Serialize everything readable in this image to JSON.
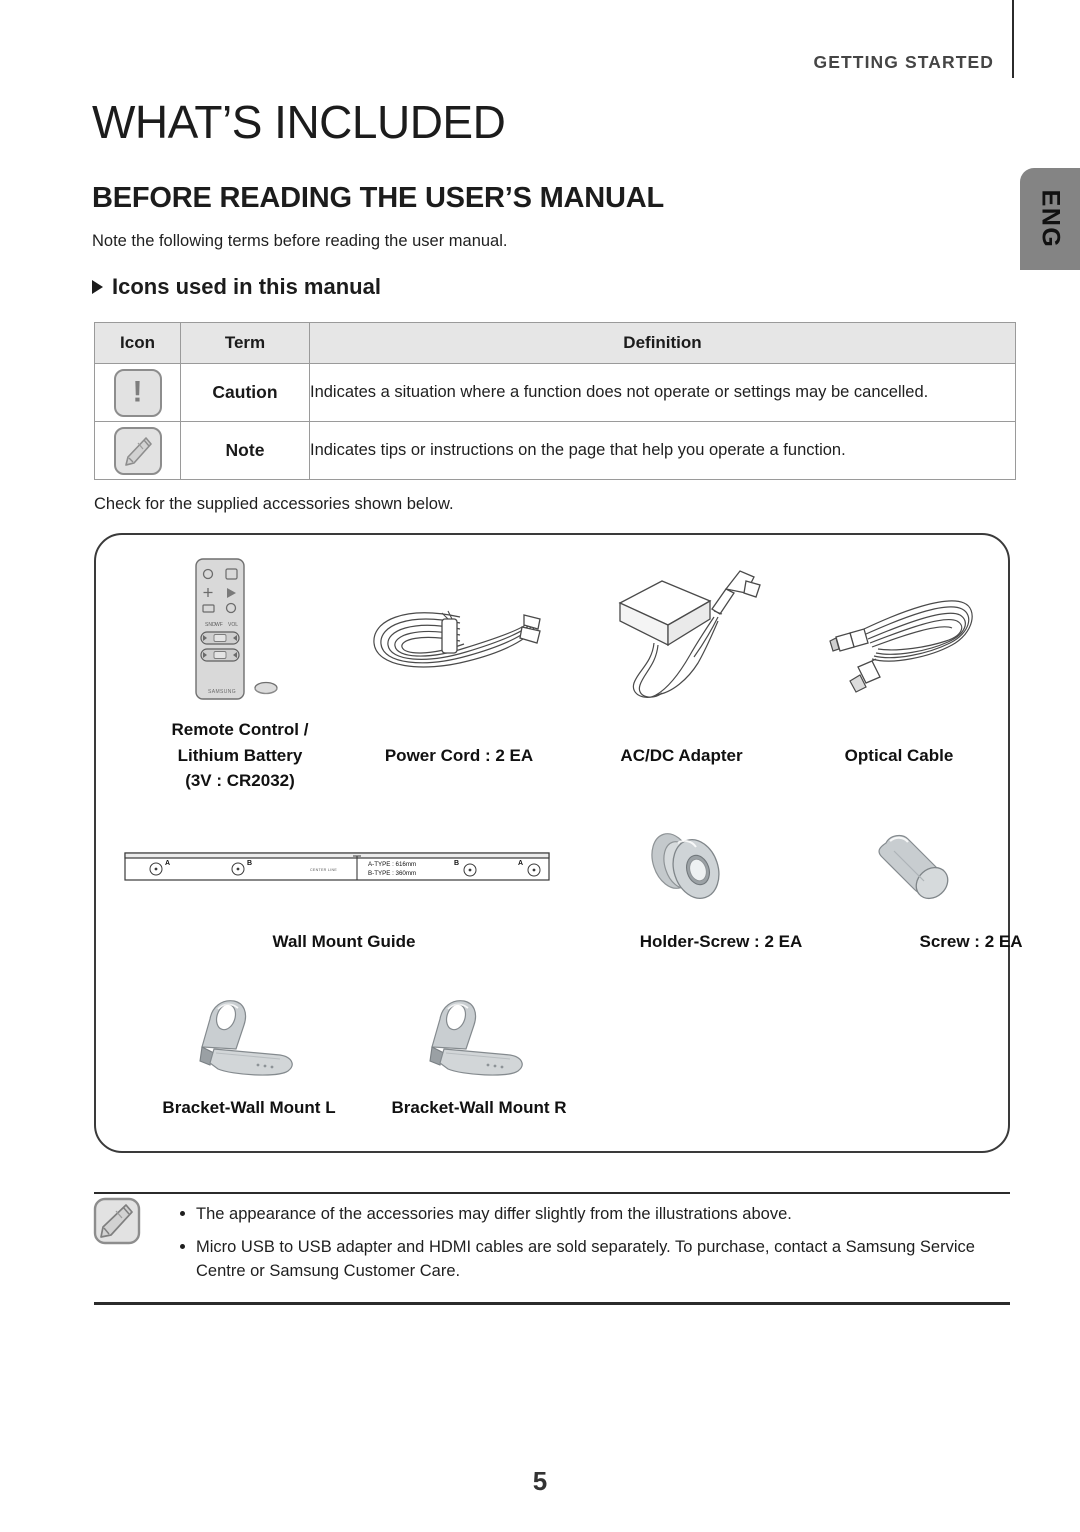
{
  "header": {
    "running_head": "GETTING STARTED",
    "language_tab": "ENG"
  },
  "page_title": "WHAT’S INCLUDED",
  "section_title": "BEFORE READING THE USER’S MANUAL",
  "intro_text": "Note the following terms before reading the user manual.",
  "sub_heading": "Icons used in this manual",
  "icon_table": {
    "headers": [
      "Icon",
      "Term",
      "Definition"
    ],
    "rows": [
      {
        "icon": "caution-icon",
        "term": "Caution",
        "definition": "Indicates a situation where a function does not operate or settings may be cancelled."
      },
      {
        "icon": "note-icon",
        "term": "Note",
        "definition": "Indicates tips or instructions on the page that help you operate a function."
      }
    ]
  },
  "check_text": "Check for the supplied accessories shown below.",
  "accessories": [
    {
      "name": "remote-control",
      "label_lines": [
        "Remote Control /",
        "Lithium Battery",
        "(3V : CR2032)"
      ],
      "brand": "SAMSUNG"
    },
    {
      "name": "power-cord",
      "label_lines": [
        "Power Cord : 2 EA"
      ]
    },
    {
      "name": "ac-dc-adapter",
      "label_lines": [
        "AC/DC Adapter"
      ]
    },
    {
      "name": "optical-cable",
      "label_lines": [
        "Optical Cable"
      ]
    },
    {
      "name": "wall-mount-guide",
      "label_lines": [
        "Wall Mount Guide"
      ],
      "guide_marks": {
        "center_line": "CENTER LINE",
        "type_a": "A-TYPE : 616mm",
        "type_b": "B-TYPE : 360mm",
        "hole_labels": [
          "A",
          "B",
          "B",
          "A"
        ]
      }
    },
    {
      "name": "holder-screw",
      "label_lines": [
        "Holder-Screw : 2 EA"
      ]
    },
    {
      "name": "screw",
      "label_lines": [
        "Screw : 2 EA"
      ]
    },
    {
      "name": "bracket-wall-mount-l",
      "label_lines": [
        "Bracket-Wall Mount L"
      ]
    },
    {
      "name": "bracket-wall-mount-r",
      "label_lines": [
        "Bracket-Wall Mount R"
      ]
    }
  ],
  "footnotes": [
    "The appearance of the accessories may differ slightly from the illustrations above.",
    "Micro USB to USB adapter and HDMI cables are sold separately. To purchase, contact a Samsung Service Centre or Samsung Customer Care."
  ],
  "page_number": "5",
  "colors": {
    "tab_gray": "#848484",
    "table_header_gray": "#e6e6e6",
    "rule_dark": "#2b2b2b",
    "metal_gray": "#b9bdc0"
  }
}
